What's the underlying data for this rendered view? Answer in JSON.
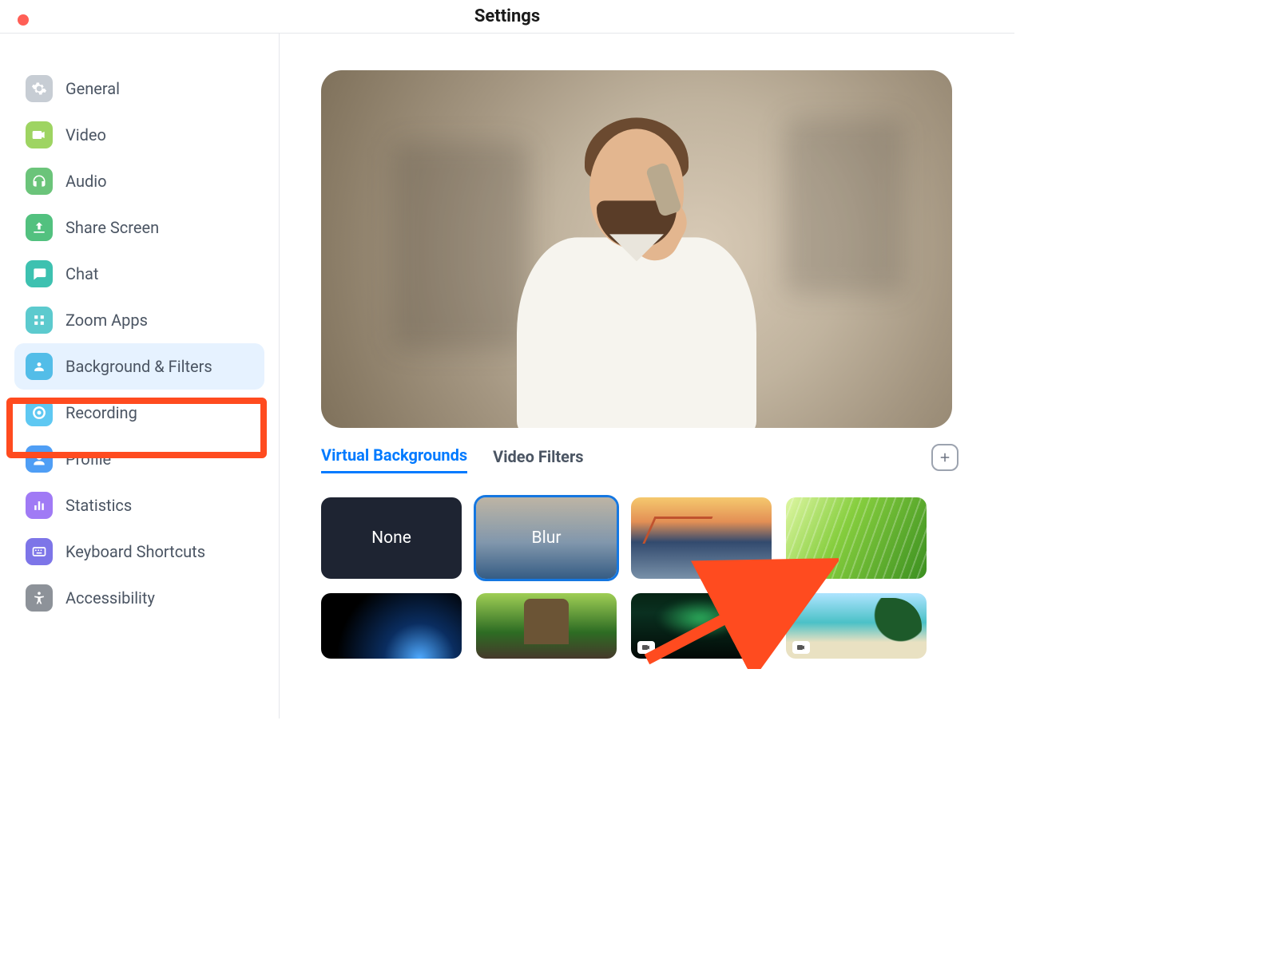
{
  "window": {
    "title": "Settings"
  },
  "sidebar": {
    "items": [
      {
        "id": "general",
        "label": "General"
      },
      {
        "id": "video",
        "label": "Video"
      },
      {
        "id": "audio",
        "label": "Audio"
      },
      {
        "id": "share-screen",
        "label": "Share Screen"
      },
      {
        "id": "chat",
        "label": "Chat"
      },
      {
        "id": "zoom-apps",
        "label": "Zoom Apps"
      },
      {
        "id": "background-filters",
        "label": "Background & Filters",
        "selected": true
      },
      {
        "id": "recording",
        "label": "Recording"
      },
      {
        "id": "profile",
        "label": "Profile"
      },
      {
        "id": "statistics",
        "label": "Statistics"
      },
      {
        "id": "keyboard-shortcuts",
        "label": "Keyboard Shortcuts"
      },
      {
        "id": "accessibility",
        "label": "Accessibility"
      }
    ]
  },
  "main": {
    "tabs": [
      {
        "id": "virtual-backgrounds",
        "label": "Virtual Backgrounds",
        "active": true
      },
      {
        "id": "video-filters",
        "label": "Video Filters",
        "active": false
      }
    ],
    "backgrounds": [
      {
        "id": "none",
        "label": "None"
      },
      {
        "id": "blur",
        "label": "Blur",
        "selected": true
      },
      {
        "id": "golden-gate-bridge",
        "label": ""
      },
      {
        "id": "grass",
        "label": ""
      },
      {
        "id": "earth-from-space",
        "label": ""
      },
      {
        "id": "jurassic-park",
        "label": ""
      },
      {
        "id": "aurora",
        "label": "",
        "is_video": true
      },
      {
        "id": "beach",
        "label": "",
        "is_video": true
      }
    ]
  },
  "annotations": {
    "highlight_target": "background-filters",
    "arrow_target": "blur",
    "highlight_color": "#ff4b1f"
  }
}
